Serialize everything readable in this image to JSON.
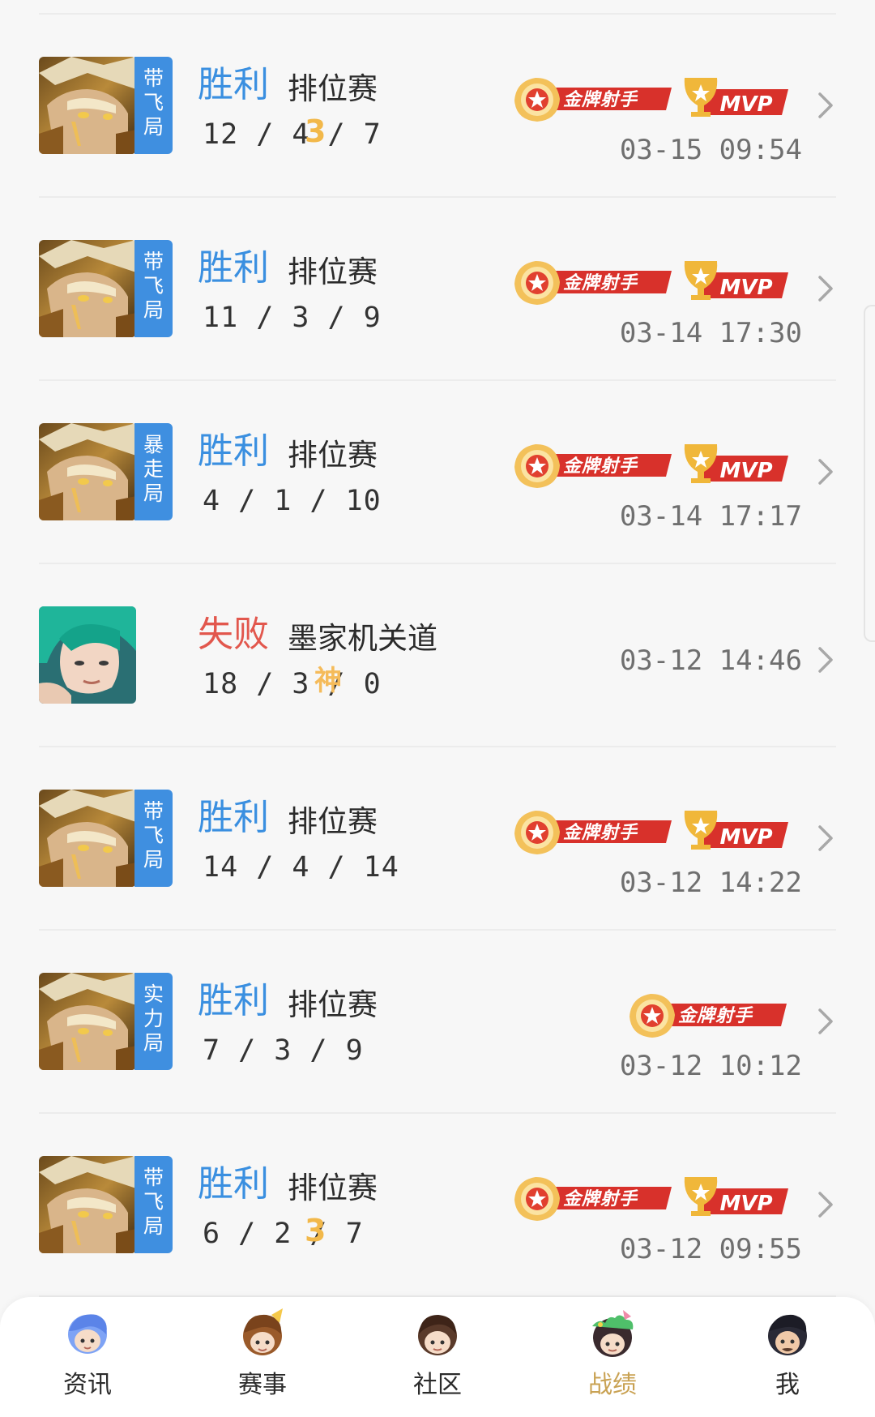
{
  "matches": [
    {
      "result": "胜利",
      "result_type": "win",
      "mode": "排位赛",
      "kda": "12 / 4 / 7",
      "grade": "3",
      "tag": [
        "带",
        "飞",
        "局"
      ],
      "badges": [
        "金牌射手",
        "MVP"
      ],
      "time": "03-15 09:54",
      "hero": "golden-hero"
    },
    {
      "result": "胜利",
      "result_type": "win",
      "mode": "排位赛",
      "kda": "11 / 3 / 9",
      "grade": "",
      "tag": [
        "带",
        "飞",
        "局"
      ],
      "badges": [
        "金牌射手",
        "MVP"
      ],
      "time": "03-14 17:30",
      "hero": "golden-hero"
    },
    {
      "result": "胜利",
      "result_type": "win",
      "mode": "排位赛",
      "kda": "4 / 1 / 10",
      "grade": "",
      "tag": [
        "暴",
        "走",
        "局"
      ],
      "badges": [
        "金牌射手",
        "MVP"
      ],
      "time": "03-14 17:17",
      "hero": "golden-hero"
    },
    {
      "result": "失败",
      "result_type": "lose",
      "mode": "墨家机关道",
      "kda": "18 / 3 / 0",
      "grade": "神",
      "tag": [],
      "badges": [],
      "time": "03-12 14:46",
      "hero": "green-hair-hero"
    },
    {
      "result": "胜利",
      "result_type": "win",
      "mode": "排位赛",
      "kda": "14 / 4 / 14",
      "grade": "",
      "tag": [
        "带",
        "飞",
        "局"
      ],
      "badges": [
        "金牌射手",
        "MVP"
      ],
      "time": "03-12 14:22",
      "hero": "golden-hero"
    },
    {
      "result": "胜利",
      "result_type": "win",
      "mode": "排位赛",
      "kda": "7 / 3 / 9",
      "grade": "",
      "tag": [
        "实",
        "力",
        "局"
      ],
      "badges": [
        "金牌射手"
      ],
      "time": "03-12 10:12",
      "hero": "golden-hero"
    },
    {
      "result": "胜利",
      "result_type": "win",
      "mode": "排位赛",
      "kda": "6 / 2 / 7",
      "grade": "3",
      "tag": [
        "带",
        "飞",
        "局"
      ],
      "badges": [
        "金牌射手",
        "MVP"
      ],
      "time": "03-12 09:55",
      "hero": "golden-hero"
    }
  ],
  "nav": [
    {
      "label": "资讯",
      "icon": "news-avatar-icon",
      "active": false
    },
    {
      "label": "赛事",
      "icon": "events-avatar-icon",
      "active": false
    },
    {
      "label": "社区",
      "icon": "community-avatar-icon",
      "active": false
    },
    {
      "label": "战绩",
      "icon": "records-avatar-icon",
      "active": true
    },
    {
      "label": "我",
      "icon": "me-avatar-icon",
      "active": false
    }
  ],
  "colors": {
    "win": "#3a8fe0",
    "lose": "#e2574d",
    "tag": "#3f8fe0",
    "active_nav": "#c9a253",
    "badge_red": "#d8312b",
    "badge_gold": "#f0b73a"
  }
}
